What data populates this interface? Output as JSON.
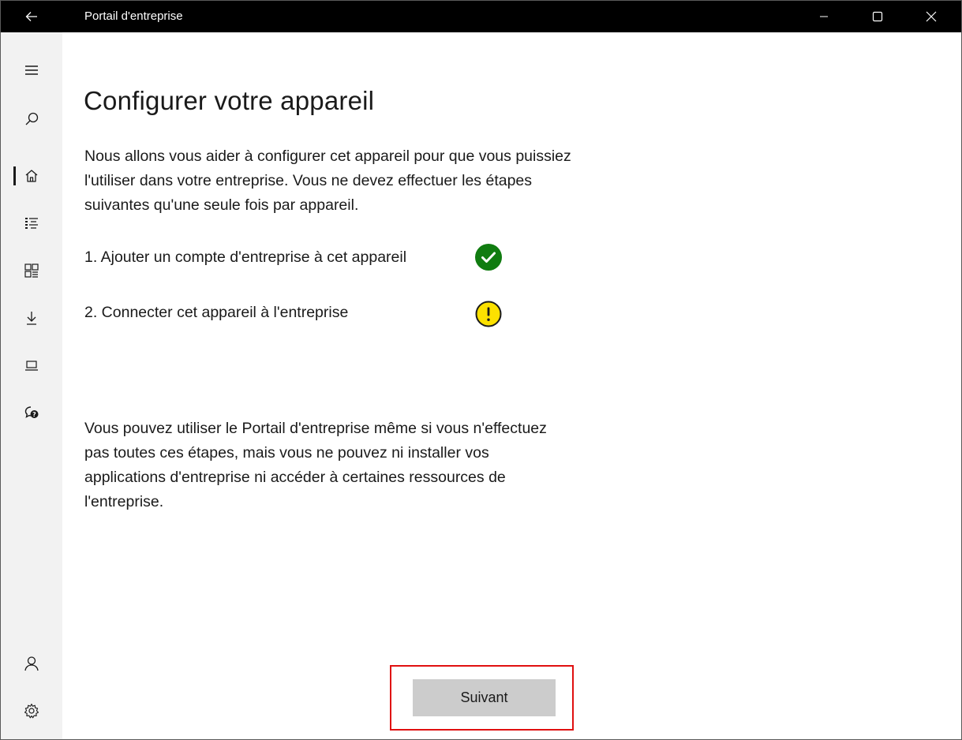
{
  "titlebar": {
    "title": "Portail d'entreprise",
    "back_icon": "back-arrow-icon",
    "minimize_icon": "minimize-icon",
    "maximize_icon": "maximize-icon",
    "close_icon": "close-icon"
  },
  "sidebar": {
    "top_items": [
      {
        "icon": "hamburger-menu-icon"
      },
      {
        "icon": "search-icon"
      },
      {
        "icon": "home-icon",
        "active": true
      },
      {
        "icon": "list-icon"
      },
      {
        "icon": "apps-grid-icon"
      },
      {
        "icon": "download-icon"
      },
      {
        "icon": "device-laptop-icon"
      },
      {
        "icon": "help-chat-icon"
      }
    ],
    "bottom_items": [
      {
        "icon": "account-icon"
      },
      {
        "icon": "settings-gear-icon"
      }
    ]
  },
  "main": {
    "title": "Configurer votre appareil",
    "intro": "Nous allons vous aider à configurer cet appareil pour que vous puissiez l'utiliser dans votre entreprise. Vous ne devez effectuer les étapes suivantes qu'une seule fois par appareil.",
    "steps": [
      {
        "label": "1. Ajouter un compte d'entreprise à cet appareil",
        "status": "complete",
        "status_icon": "checkmark-circle-icon",
        "color": "#107c10"
      },
      {
        "label": "2. Connecter cet appareil à l'entreprise",
        "status": "warning",
        "status_icon": "warning-circle-icon",
        "color": "#fce100"
      }
    ],
    "note": "Vous pouvez utiliser le Portail d'entreprise même si vous n'effectuez pas toutes ces étapes, mais vous ne pouvez ni installer vos applications d'entreprise ni accéder à certaines ressources de l'entreprise.",
    "next_label": "Suivant"
  },
  "colors": {
    "titlebar_bg": "#000000",
    "sidebar_bg": "#f2f2f2",
    "button_bg": "#cccccc",
    "highlight_border": "#e01010"
  }
}
